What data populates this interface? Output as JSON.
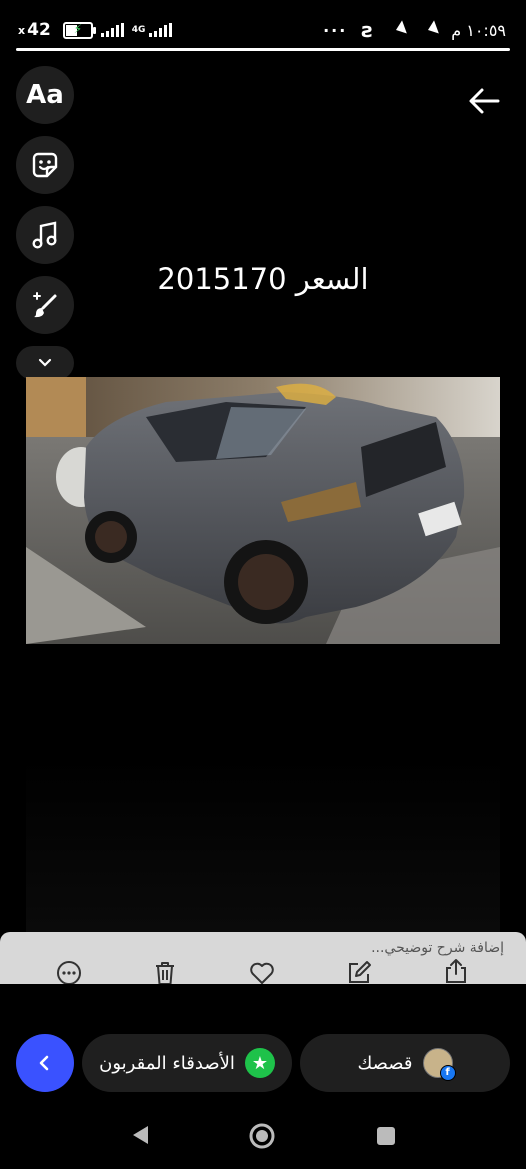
{
  "status_bar": {
    "battery": "42",
    "network": "4G",
    "time": "١٠:٥٩ م",
    "more": "···"
  },
  "tools": {
    "text_label": "Aa"
  },
  "story": {
    "caption": "2015السعر 170"
  },
  "edit_bar": {
    "caption_placeholder": "إضافة شرح توضيحي..."
  },
  "share": {
    "close_friends_label": "الأصدقاء المقربون",
    "your_story_label": "قصصك"
  },
  "colors": {
    "accent_blue": "#3a52ff",
    "close_friends_green": "#1ec24a",
    "edit_bar_bg": "#d8d8d8"
  }
}
